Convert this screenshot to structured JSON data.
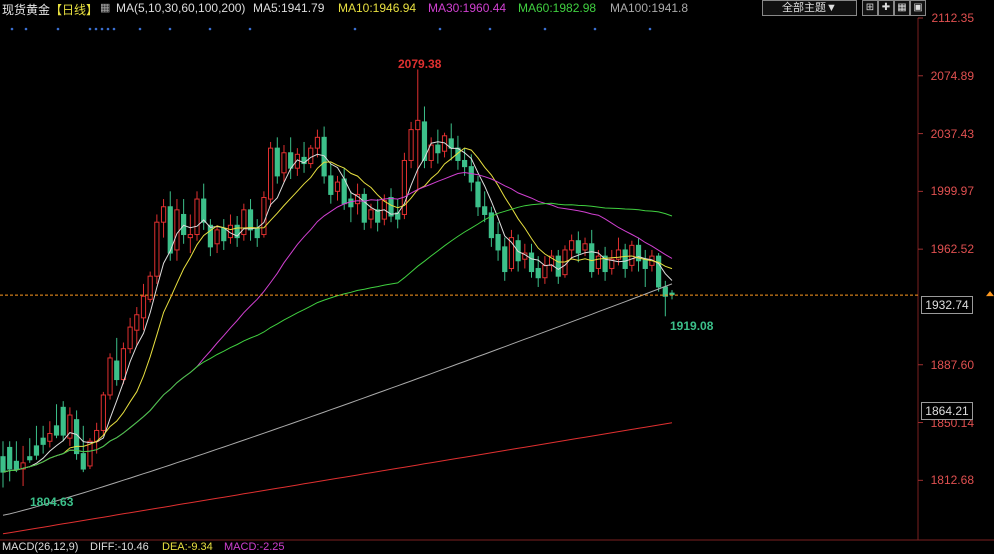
{
  "header": {
    "symbol": "现货黄金",
    "period": "【日线】",
    "ma_label": "MA(5,10,30,60,100,200)",
    "ma5": "MA5:1941.79",
    "ma10": "MA10:1946.94",
    "ma30": "MA30:1960.44",
    "ma60": "MA60:1982.98",
    "ma100": "MA100:1941.8",
    "theme_selector": "全部主题▼"
  },
  "toolbar_icons": [
    "plus-grid-icon",
    "cross-icon",
    "tile-icon",
    "fullscreen-icon"
  ],
  "indicator": {
    "macd": "MACD(26,12,9)",
    "diff": "DIFF:-10.46",
    "dea": "DEA:-9.34",
    "macd_val": "MACD:-2.25"
  },
  "colors": {
    "up": "#e03030",
    "down": "#3cc08a",
    "ma5": "#dddddd",
    "ma10": "#e8e040",
    "ma30": "#d040d0",
    "ma60": "#40d040",
    "ma100": "#aaaaaa",
    "ma200": "#e03030",
    "current_line": "#ff9a20"
  },
  "chart_data": {
    "type": "candlestick",
    "y_ticks": [
      "2112.35",
      "2074.89",
      "2037.43",
      "1999.97",
      "1962.52",
      "1887.60",
      "1850.14",
      "1812.68"
    ],
    "ylim": [
      1774,
      2112.35
    ],
    "current_price": "1932.74",
    "crosshair_price": "1864.21",
    "annotations": {
      "high": "2079.38",
      "low_left": "1804.63",
      "low_right": "1919.08"
    },
    "candles": [
      [
        1828,
        1838,
        1818,
        1808
      ],
      [
        1834,
        1838,
        1820,
        1812
      ],
      [
        1825,
        1838,
        1820,
        1818
      ],
      [
        1820,
        1835,
        1824,
        1809
      ],
      [
        1828,
        1840,
        1826,
        1824
      ],
      [
        1835,
        1848,
        1829,
        1826
      ],
      [
        1840,
        1848,
        1836,
        1830
      ],
      [
        1838,
        1851,
        1843,
        1834
      ],
      [
        1848,
        1862,
        1842,
        1840
      ],
      [
        1860,
        1864,
        1842,
        1838
      ],
      [
        1840,
        1860,
        1855,
        1835
      ],
      [
        1852,
        1858,
        1830,
        1826
      ],
      [
        1830,
        1848,
        1820,
        1818
      ],
      [
        1822,
        1840,
        1838,
        1820
      ],
      [
        1838,
        1850,
        1845,
        1830
      ],
      [
        1845,
        1870,
        1868,
        1842
      ],
      [
        1868,
        1895,
        1892,
        1865
      ],
      [
        1890,
        1905,
        1878,
        1874
      ],
      [
        1878,
        1902,
        1898,
        1875
      ],
      [
        1898,
        1918,
        1912,
        1895
      ],
      [
        1910,
        1925,
        1920,
        1900
      ],
      [
        1918,
        1940,
        1932,
        1910
      ],
      [
        1930,
        1948,
        1945,
        1928
      ],
      [
        1945,
        1985,
        1980,
        1940
      ],
      [
        1980,
        1995,
        1990,
        1970
      ],
      [
        1990,
        2000,
        1960,
        1955
      ],
      [
        1962,
        1995,
        1988,
        1955
      ],
      [
        1985,
        1995,
        1972,
        1966
      ],
      [
        1970,
        1985,
        1972,
        1960
      ],
      [
        1972,
        2000,
        1995,
        1968
      ],
      [
        1995,
        2005,
        1980,
        1975
      ],
      [
        1978,
        1982,
        1964,
        1958
      ],
      [
        1966,
        1978,
        1975,
        1960
      ],
      [
        1976,
        1982,
        1968,
        1962
      ],
      [
        1970,
        1985,
        1978,
        1966
      ],
      [
        1978,
        1984,
        1970,
        1964
      ],
      [
        1972,
        1992,
        1988,
        1968
      ],
      [
        1988,
        1995,
        1975,
        1968
      ],
      [
        1976,
        1982,
        1970,
        1964
      ],
      [
        1972,
        2000,
        1996,
        1970
      ],
      [
        1995,
        2032,
        2028,
        1990
      ],
      [
        2028,
        2035,
        2010,
        2005
      ],
      [
        2012,
        2030,
        2025,
        2006
      ],
      [
        2025,
        2035,
        2015,
        2008
      ],
      [
        2015,
        2028,
        2024,
        2010
      ],
      [
        2022,
        2032,
        2018,
        2012
      ],
      [
        2018,
        2030,
        2028,
        2015
      ],
      [
        2028,
        2040,
        2035,
        2022
      ],
      [
        2035,
        2042,
        2010,
        2005
      ],
      [
        2010,
        2018,
        1998,
        1992
      ],
      [
        2000,
        2010,
        2006,
        1994
      ],
      [
        2008,
        2015,
        1992,
        1988
      ],
      [
        1995,
        2000,
        1990,
        1980
      ],
      [
        1992,
        2005,
        1998,
        1985
      ],
      [
        1998,
        2002,
        1980,
        1975
      ],
      [
        1982,
        1992,
        1988,
        1976
      ],
      [
        1988,
        1995,
        1980,
        1974
      ],
      [
        1982,
        1998,
        1994,
        1978
      ],
      [
        1996,
        2002,
        1984,
        1980
      ],
      [
        1986,
        1995,
        1982,
        1976
      ],
      [
        1985,
        2025,
        2020,
        1982
      ],
      [
        2020,
        2045,
        2040,
        2015
      ],
      [
        2040,
        2079,
        2046,
        2000
      ],
      [
        2045,
        2055,
        2020,
        2015
      ],
      [
        2020,
        2035,
        2030,
        2015
      ],
      [
        2030,
        2040,
        2025,
        2018
      ],
      [
        2026,
        2038,
        2036,
        2022
      ],
      [
        2034,
        2044,
        2028,
        2020
      ],
      [
        2028,
        2036,
        2020,
        2014
      ],
      [
        2020,
        2028,
        2016,
        2010
      ],
      [
        2016,
        2024,
        2006,
        2000
      ],
      [
        2006,
        2010,
        1990,
        1984
      ],
      [
        1990,
        2000,
        1985,
        1980
      ],
      [
        1986,
        1990,
        1970,
        1964
      ],
      [
        1972,
        1980,
        1962,
        1955
      ],
      [
        1964,
        1970,
        1948,
        1942
      ],
      [
        1950,
        1975,
        1970,
        1948
      ],
      [
        1968,
        1972,
        1955,
        1948
      ],
      [
        1956,
        1966,
        1960,
        1950
      ],
      [
        1960,
        1966,
        1948,
        1944
      ],
      [
        1950,
        1958,
        1944,
        1938
      ],
      [
        1944,
        1958,
        1952,
        1940
      ],
      [
        1952,
        1962,
        1958,
        1948
      ],
      [
        1958,
        1962,
        1945,
        1940
      ],
      [
        1946,
        1965,
        1962,
        1944
      ],
      [
        1962,
        1972,
        1968,
        1956
      ],
      [
        1968,
        1974,
        1960,
        1954
      ],
      [
        1962,
        1970,
        1966,
        1958
      ],
      [
        1966,
        1975,
        1948,
        1944
      ],
      [
        1950,
        1962,
        1958,
        1946
      ],
      [
        1958,
        1964,
        1948,
        1942
      ],
      [
        1950,
        1962,
        1956,
        1946
      ],
      [
        1956,
        1970,
        1962,
        1952
      ],
      [
        1962,
        1966,
        1950,
        1944
      ],
      [
        1952,
        1968,
        1965,
        1948
      ],
      [
        1965,
        1970,
        1955,
        1948
      ],
      [
        1956,
        1962,
        1950,
        1938
      ],
      [
        1952,
        1962,
        1958,
        1948
      ],
      [
        1958,
        1960,
        1938,
        1935
      ],
      [
        1938,
        1942,
        1932,
        1919
      ],
      [
        1934,
        1936,
        1933,
        1930
      ]
    ]
  }
}
